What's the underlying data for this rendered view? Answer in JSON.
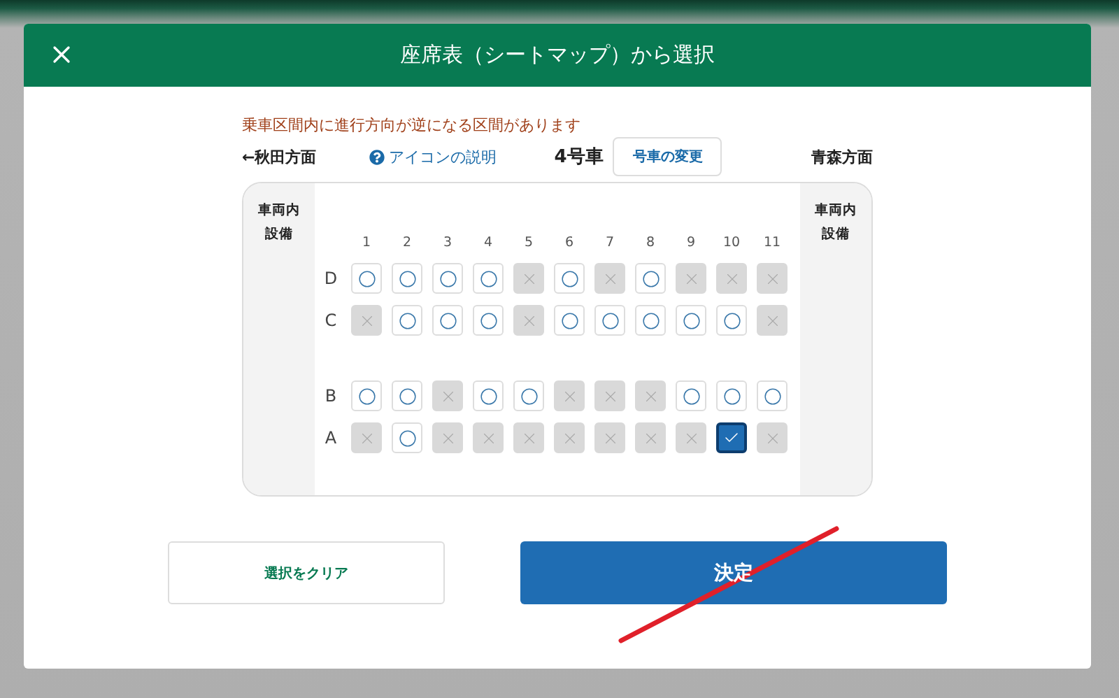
{
  "header": {
    "title": "座席表（シートマップ）から選択"
  },
  "notice": "乗車区間内に進行方向が逆になる区間があります",
  "car_bar": {
    "direction_left": "←秋田方面",
    "help_link": "アイコンの説明",
    "car_number": "4号車",
    "change_car_button": "号車の変更",
    "direction_right": "青森方面"
  },
  "seat_map": {
    "left_panel": [
      "車両内",
      "設備"
    ],
    "right_panel": [
      "車両内",
      "設備"
    ],
    "columns": [
      "1",
      "2",
      "3",
      "4",
      "5",
      "6",
      "7",
      "8",
      "9",
      "10",
      "11"
    ],
    "rows": [
      {
        "label": "D",
        "seats": [
          {
            "available": true,
            "selected": false
          },
          {
            "available": true,
            "selected": false
          },
          {
            "available": true,
            "selected": false
          },
          {
            "available": true,
            "selected": false
          },
          {
            "available": false,
            "selected": false
          },
          {
            "available": true,
            "selected": false
          },
          {
            "available": false,
            "selected": false
          },
          {
            "available": true,
            "selected": false
          },
          {
            "available": false,
            "selected": false
          },
          {
            "available": false,
            "selected": false
          },
          {
            "available": false,
            "selected": false
          }
        ]
      },
      {
        "label": "C",
        "seats": [
          {
            "available": false,
            "selected": false
          },
          {
            "available": true,
            "selected": false
          },
          {
            "available": true,
            "selected": false
          },
          {
            "available": true,
            "selected": false
          },
          {
            "available": false,
            "selected": false
          },
          {
            "available": true,
            "selected": false
          },
          {
            "available": true,
            "selected": false
          },
          {
            "available": true,
            "selected": false
          },
          {
            "available": true,
            "selected": false
          },
          {
            "available": true,
            "selected": false
          },
          {
            "available": false,
            "selected": false
          }
        ]
      },
      {
        "label": "B",
        "seats": [
          {
            "available": true,
            "selected": false
          },
          {
            "available": true,
            "selected": false
          },
          {
            "available": false,
            "selected": false
          },
          {
            "available": true,
            "selected": false
          },
          {
            "available": true,
            "selected": false
          },
          {
            "available": false,
            "selected": false
          },
          {
            "available": false,
            "selected": false
          },
          {
            "available": false,
            "selected": false
          },
          {
            "available": true,
            "selected": false
          },
          {
            "available": true,
            "selected": false
          },
          {
            "available": true,
            "selected": false
          }
        ]
      },
      {
        "label": "A",
        "seats": [
          {
            "available": false,
            "selected": false
          },
          {
            "available": true,
            "selected": false
          },
          {
            "available": false,
            "selected": false
          },
          {
            "available": false,
            "selected": false
          },
          {
            "available": false,
            "selected": false
          },
          {
            "available": false,
            "selected": false
          },
          {
            "available": false,
            "selected": false
          },
          {
            "available": false,
            "selected": false
          },
          {
            "available": false,
            "selected": false
          },
          {
            "available": true,
            "selected": true
          },
          {
            "available": false,
            "selected": false
          }
        ]
      }
    ]
  },
  "buttons": {
    "clear": "選択をクリア",
    "confirm": "決定"
  }
}
